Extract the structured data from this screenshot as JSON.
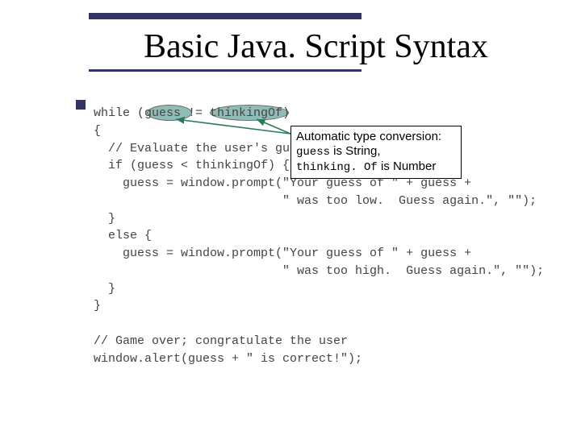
{
  "title": "Basic Java. Script Syntax",
  "callout": {
    "line1": "Automatic type conversion:",
    "code1": "guess",
    "text1": " is String,",
    "code2": "thinking. Of",
    "text2": " is Number"
  },
  "code": {
    "l1": "while (guess != thinkingOf)",
    "l2": "{",
    "l3": "  // Evaluate the user's guess",
    "l4": "  if (guess < thinkingOf) {",
    "l5": "    guess = window.prompt(\"Your guess of \" + guess +",
    "l6": "                          \" was too low.  Guess again.\", \"\");",
    "l7": "  }",
    "l8": "  else {",
    "l9": "    guess = window.prompt(\"Your guess of \" + guess +",
    "l10": "                          \" was too high.  Guess again.\", \"\");",
    "l11": "  }",
    "l12": "}",
    "l13": "",
    "l14": "// Game over; congratulate the user",
    "l15": "window.alert(guess + \" is correct!\");"
  }
}
